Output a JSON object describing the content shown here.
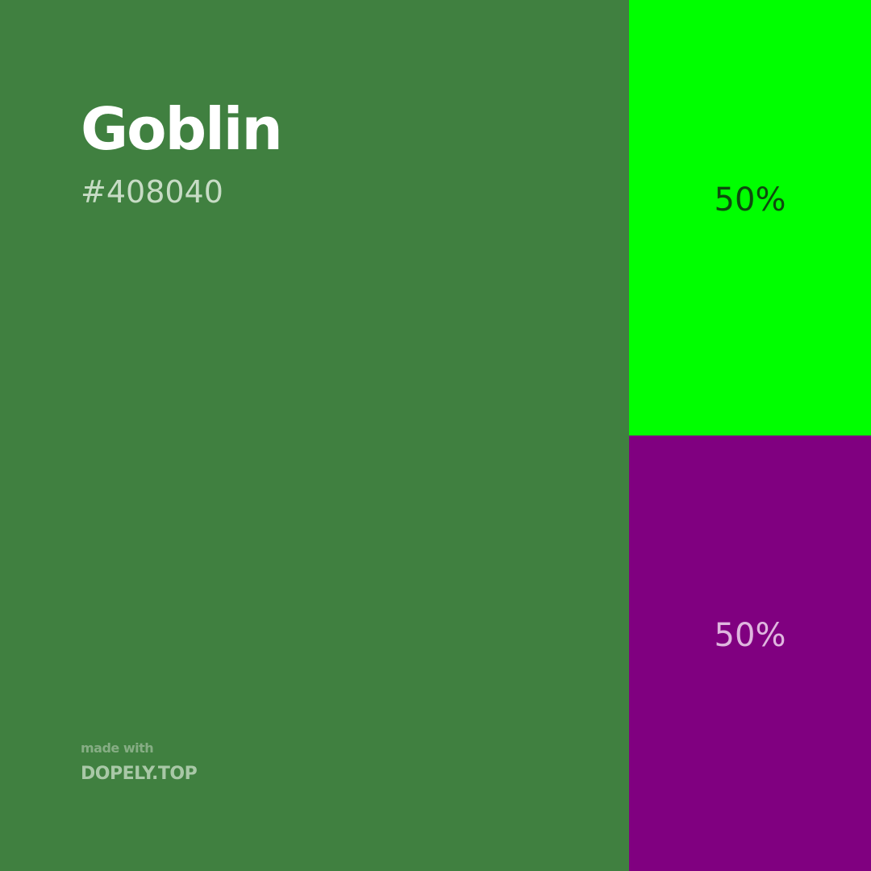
{
  "color": {
    "name": "Goblin",
    "hex": "#408040"
  },
  "palette": [
    {
      "percent": "50%",
      "swatch_color": "#00ff00"
    },
    {
      "percent": "50%",
      "swatch_color": "#800080"
    }
  ],
  "footer": {
    "made_with": "made with",
    "brand": "DOPELY.TOP"
  }
}
